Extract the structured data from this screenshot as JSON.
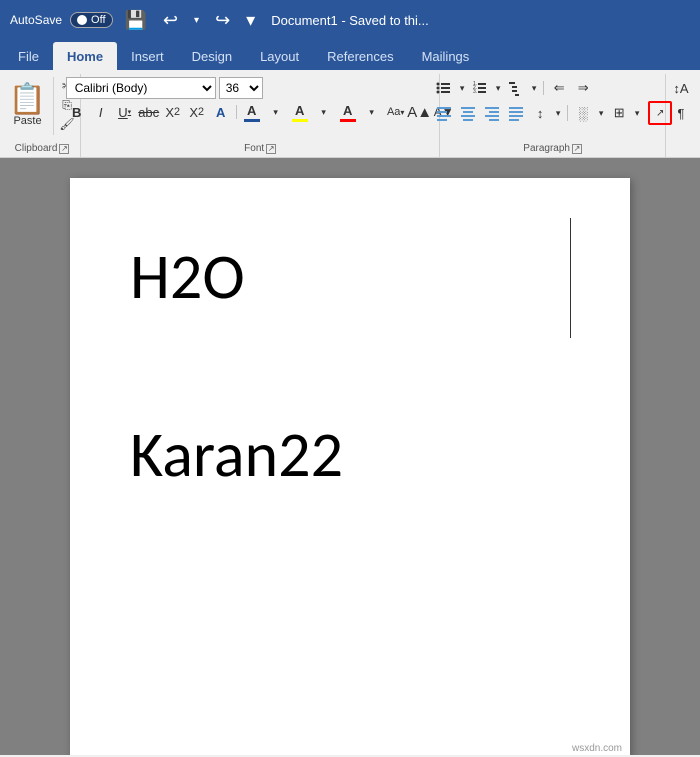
{
  "titleBar": {
    "autosave_label": "AutoSave",
    "toggle_state": "Off",
    "document_title": "Document1  -  Saved to thi...",
    "undo_label": "Undo",
    "redo_label": "Redo",
    "quick_access_label": "Quick Access"
  },
  "ribbon": {
    "tabs": [
      {
        "label": "File",
        "active": false
      },
      {
        "label": "Home",
        "active": true
      },
      {
        "label": "Insert",
        "active": false
      },
      {
        "label": "Design",
        "active": false
      },
      {
        "label": "Layout",
        "active": false
      },
      {
        "label": "References",
        "active": false
      },
      {
        "label": "Mailings",
        "active": false
      }
    ],
    "groups": {
      "clipboard": {
        "label": "Clipboard",
        "paste": "Paste",
        "cut": "✂",
        "copy": "⎘",
        "format_painter": "🖌"
      },
      "font": {
        "label": "Font",
        "font_name": "Calibri (Body)",
        "font_size": "36",
        "bold": "B",
        "italic": "I",
        "underline": "U",
        "strikethrough": "S",
        "subscript": "X₂",
        "superscript": "X²",
        "text_effects": "A",
        "font_color": "A",
        "highlight_color": "A",
        "clear_format": "A"
      },
      "paragraph": {
        "label": "Paragraph",
        "bullets": "≡",
        "numbering": "≡",
        "multilevel": "≡",
        "indent_decrease": "⇐",
        "indent_increase": "⇒",
        "align_left": "≡",
        "align_center": "≡",
        "align_right": "≡",
        "justify": "≡",
        "line_spacing": "↕≡",
        "shading": "░",
        "borders": "⊞",
        "sort": "↕A",
        "show_para": "¶"
      }
    }
  },
  "document": {
    "text_h2o": "H2O",
    "text_karan": "Karan22"
  },
  "watermark": "wsxdn.com"
}
